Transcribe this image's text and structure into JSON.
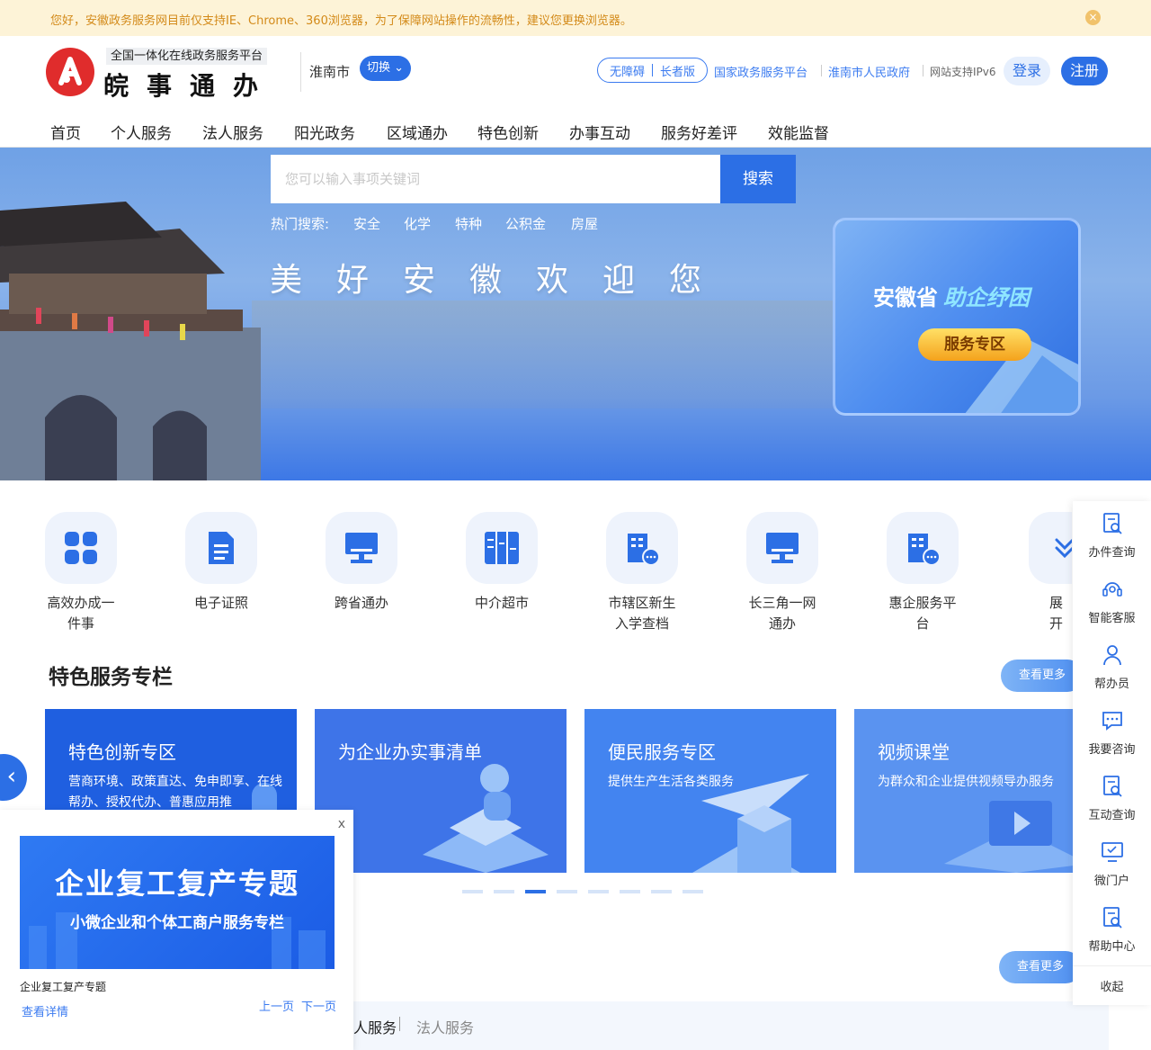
{
  "notice": {
    "text": "您好，安徽政务服务网目前仅支持IE、Chrome、360浏览器，为了保障网站操作的流畅性，建议您更换浏览器。"
  },
  "header": {
    "platform_subtitle": "全国一体化在线政务服务平台",
    "platform_name": "皖事通办",
    "city": "淮南市",
    "switch_label": "切换",
    "accessible_label": "无障碍",
    "elder_label": "长者版",
    "links": [
      "国家政务服务平台",
      "淮南市人民政府"
    ],
    "ipv6_text": "网站支持IPv6",
    "login_label": "登录",
    "register_label": "注册"
  },
  "nav": [
    "首页",
    "个人服务",
    "法人服务",
    "阳光政务",
    "区域通办",
    "特色创新",
    "办事互动",
    "服务好差评",
    "效能监督"
  ],
  "banner": {
    "title": "美好安徽欢迎您",
    "search_placeholder": "您可以输入事项关键词",
    "search_button": "搜索",
    "hot_label": "热门搜索:",
    "hot_items": [
      "安全",
      "化学",
      "特种",
      "公积金",
      "房屋"
    ],
    "promo_title": "安徽省",
    "promo_highlight": "助企纾困",
    "promo_button": "服务专区"
  },
  "quick_services": [
    {
      "label": "高效办成一件事",
      "icon": "grid-icon"
    },
    {
      "label": "电子证照",
      "icon": "document-icon"
    },
    {
      "label": "跨省通办",
      "icon": "monitor-icon"
    },
    {
      "label": "中介超市",
      "icon": "shelf-icon"
    },
    {
      "label": "市辖区新生入学查档",
      "icon": "building-chat-icon"
    },
    {
      "label": "长三角一网通办",
      "icon": "monitor-icon"
    },
    {
      "label": "惠企服务平台",
      "icon": "building-chat-icon"
    },
    {
      "label": "展开",
      "icon": "chevron-down-icon"
    }
  ],
  "featured": {
    "title": "特色服务专栏",
    "more_label": "查看更多",
    "cards": [
      {
        "title": "特色创新专区",
        "desc": "营商环境、政策直达、免申即享、在线帮办、授权代办、普惠应用推",
        "color": "#1f5fe0"
      },
      {
        "title": "为企业办实事清单",
        "desc": "",
        "color": "#3e74e8"
      },
      {
        "title": "便民服务专区",
        "desc": "提供生产生活各类服务",
        "color": "#4384f0"
      },
      {
        "title": "视频课堂",
        "desc": "为群众和企业提供视频导办服务",
        "color": "#5a93f0"
      }
    ],
    "active_dot": 2,
    "dot_count": 8
  },
  "popup": {
    "close_label": "x",
    "image_title": "企业复工复产专题",
    "image_subtitle": "小微企业和个体工商户服务专栏",
    "caption": "企业复工复产专题",
    "detail_link": "查看详情",
    "prev_label": "上一页",
    "next_label": "下一页"
  },
  "second_more_label": "查看更多",
  "bottom_tabs": [
    "人服务",
    "法人服务"
  ],
  "float_toolbar": {
    "items": [
      {
        "label": "办件查询",
        "icon": "search-doc-icon"
      },
      {
        "label": "智能客服",
        "icon": "robot-icon"
      },
      {
        "label": "帮办员",
        "icon": "person-icon"
      },
      {
        "label": "我要咨询",
        "icon": "chat-icon"
      },
      {
        "label": "互动查询",
        "icon": "search-doc-icon"
      },
      {
        "label": "微门户",
        "icon": "monitor-icon"
      },
      {
        "label": "帮助中心",
        "icon": "search-doc-icon"
      }
    ],
    "collapse_label": "收起"
  },
  "colors": {
    "brand": "#2c6fe5",
    "logo_red": "#e02c2c",
    "notice_text": "#d38a19"
  }
}
